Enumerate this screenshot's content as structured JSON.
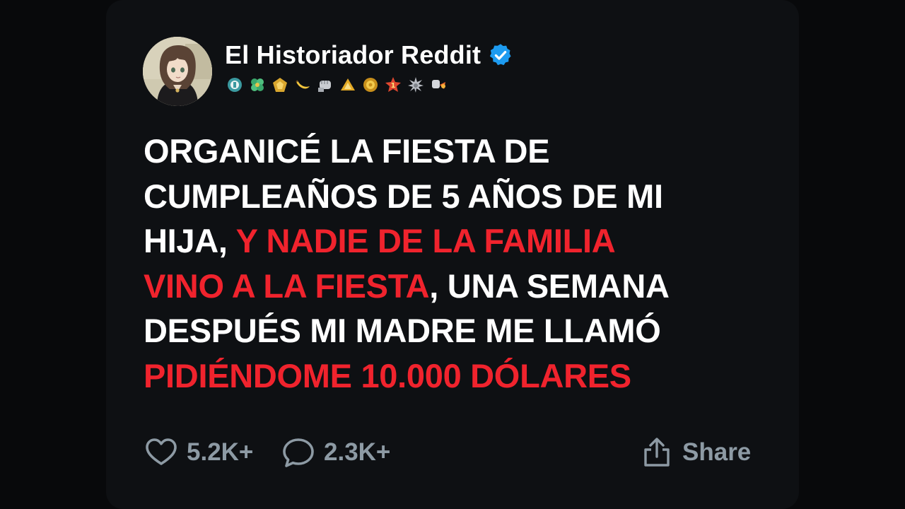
{
  "post": {
    "author": {
      "name": "El Historiador Reddit",
      "verified": true,
      "avatar": "anime-girl-avatar",
      "badges": [
        "teal-round-badge",
        "green-clover-badge",
        "gold-pentagon-badge",
        "banana-badge",
        "silver-fist-badge",
        "gold-triangle-badge",
        "gold-sun-badge",
        "number-one-badge",
        "silver-spiky-badge",
        "rocket-hand-badge"
      ]
    },
    "text_lines": [
      [
        {
          "text": "ORGANICÉ LA FIESTA DE",
          "highlight": false
        }
      ],
      [
        {
          "text": "CUMPLEAÑOS DE 5 AÑOS DE MI",
          "highlight": false
        }
      ],
      [
        {
          "text": "HIJA, ",
          "highlight": false
        },
        {
          "text": "Y NADIE DE LA FAMILIA",
          "highlight": true
        }
      ],
      [
        {
          "text": "VINO A LA FIESTA",
          "highlight": true
        },
        {
          "text": ", UNA SEMANA",
          "highlight": false
        }
      ],
      [
        {
          "text": "DESPUÉS MI MADRE ME LLAMÓ",
          "highlight": false
        }
      ],
      [
        {
          "text": "PIDIÉNDOME 10.000 DÓLARES",
          "highlight": true
        }
      ]
    ],
    "stats": {
      "likes": "5.2K+",
      "comments": "2.3K+",
      "share_label": "Share"
    }
  },
  "colors": {
    "background": "#08090b",
    "card": "#0e1013",
    "text": "#ffffff",
    "highlight": "#f0232d",
    "muted": "#8d9aa4",
    "verified": "#1d9bf0"
  }
}
